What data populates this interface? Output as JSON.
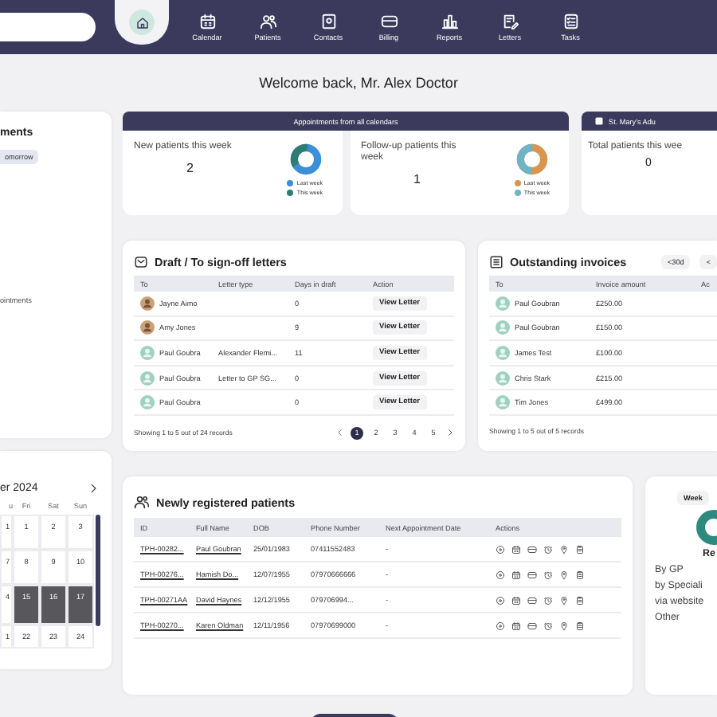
{
  "nav_items": [
    {
      "selected": true
    },
    {
      "label": "Calendar",
      "selected": false
    },
    {
      "label": "Patients",
      "selected": false
    },
    {
      "label": "Contacts",
      "selected": false
    },
    {
      "label": "Billing",
      "selected": false
    },
    {
      "label": "Reports",
      "selected": false
    },
    {
      "label": "Letters",
      "selected": false
    },
    {
      "label": "Tasks",
      "selected": false
    }
  ],
  "welcome": "Welcome back, Mr. Alex Doctor",
  "left_card": {
    "title": "ments",
    "chip": "omorrow",
    "note": "ointments"
  },
  "appointments": {
    "header": "Appointments from all calendars",
    "stats": [
      {
        "label": "New patients this week",
        "value": "2",
        "legend": [
          {
            "label": "Last week",
            "color": "#3a8fd6"
          },
          {
            "label": "This week",
            "color": "#2e7d72"
          }
        ]
      },
      {
        "label": "Follow-up patients this week",
        "value": "1",
        "legend": [
          {
            "label": "Last week",
            "color": "#d9944f"
          },
          {
            "label": "This week",
            "color": "#6fb3c5"
          }
        ]
      }
    ]
  },
  "clinic": {
    "header": "St. Mary's Adu",
    "label": "Total patients this wee",
    "value": "0"
  },
  "letters": {
    "title": "Draft / To sign-off letters",
    "columns": [
      "To",
      "Letter type",
      "Days in draft",
      "Action"
    ],
    "rows": [
      {
        "kind": "photo",
        "to": "Jayne Aimo",
        "days": "0",
        "action": "View Letter"
      },
      {
        "kind": "photo",
        "to": "Amy Jones",
        "days": "9",
        "action": "View Letter"
      },
      {
        "kind": "default",
        "to": "Paul Goubra",
        "letter_type": "Alexander Flemi...",
        "days": "11",
        "action": "View Letter"
      },
      {
        "kind": "default",
        "to": "Paul Goubra",
        "letter_type": "Letter to GP SG...",
        "days": "0",
        "action": "View Letter"
      },
      {
        "kind": "default",
        "to": "Paul Goubra",
        "days": "0",
        "action": "View Letter"
      }
    ],
    "footer": "Showing 1 to 5 out of 24 records",
    "pages": [
      {
        "label": "1",
        "selected": true
      },
      {
        "label": "2",
        "selected": false
      },
      {
        "label": "3",
        "selected": false
      },
      {
        "label": "4",
        "selected": false
      },
      {
        "label": "5",
        "selected": false
      }
    ]
  },
  "invoices": {
    "title": "Outstanding invoices",
    "filters": [
      "<30d",
      "<"
    ],
    "columns": [
      "To",
      "Invoice amount",
      "Ac"
    ],
    "rows": [
      {
        "to": "Paul Goubran",
        "amount": "£250.00"
      },
      {
        "to": "Paul Goubran",
        "amount": "£150.00"
      },
      {
        "to": "James Test",
        "amount": "£100.00"
      },
      {
        "to": "Chris Stark",
        "amount": "£215.00"
      },
      {
        "to": "Tim Jones",
        "amount": "£499.00"
      }
    ],
    "footer": "Showing 1 to 5 out of 5 records"
  },
  "calendar": {
    "month": "er 2024",
    "weekdays": [
      "u",
      "Fri",
      "Sat",
      "Sun"
    ],
    "weeks": [
      [
        {
          "day": "1",
          "selected": false
        },
        {
          "day": "1",
          "selected": false
        },
        {
          "day": "2",
          "selected": false
        },
        {
          "day": "3",
          "selected": false
        }
      ],
      [
        {
          "day": "7",
          "selected": false
        },
        {
          "day": "8",
          "selected": false
        },
        {
          "day": "9",
          "selected": false
        },
        {
          "day": "10",
          "selected": false
        }
      ],
      [
        {
          "day": "4",
          "selected": false
        },
        {
          "day": "15",
          "selected": true
        },
        {
          "day": "16",
          "selected": true
        },
        {
          "day": "17",
          "selected": true
        }
      ],
      [
        {
          "day": "1",
          "selected": false
        },
        {
          "day": "22",
          "selected": false
        },
        {
          "day": "23",
          "selected": false
        },
        {
          "day": "24",
          "selected": false
        }
      ]
    ]
  },
  "patients": {
    "title": "Newly registered patients",
    "columns": [
      "ID",
      "Full Name",
      "DOB",
      "Phone Number",
      "Next Appointment Date",
      "Actions"
    ],
    "rows": [
      {
        "id": "TPH-00282...",
        "name": "Paul Goubran",
        "dob": "25/01/1983",
        "phone": "07411552483",
        "next": "-"
      },
      {
        "id": "TPH-00276...",
        "name": "Hamish Do...",
        "dob": "12/07/1955",
        "phone": "07970666666",
        "next": "-"
      },
      {
        "id": "TPH-00271AA",
        "name": "David Haynes",
        "dob": "12/12/1955",
        "phone": "079706994...",
        "next": "-"
      },
      {
        "id": "TPH-00270...",
        "name": "Karen Oldman",
        "dob": "12/11/1956",
        "phone": "07970699000",
        "next": "-"
      }
    ]
  },
  "referrals": {
    "chip": "Week",
    "title": "Re",
    "items": [
      "By GP",
      "by Speciali",
      "via website",
      "Other"
    ]
  }
}
